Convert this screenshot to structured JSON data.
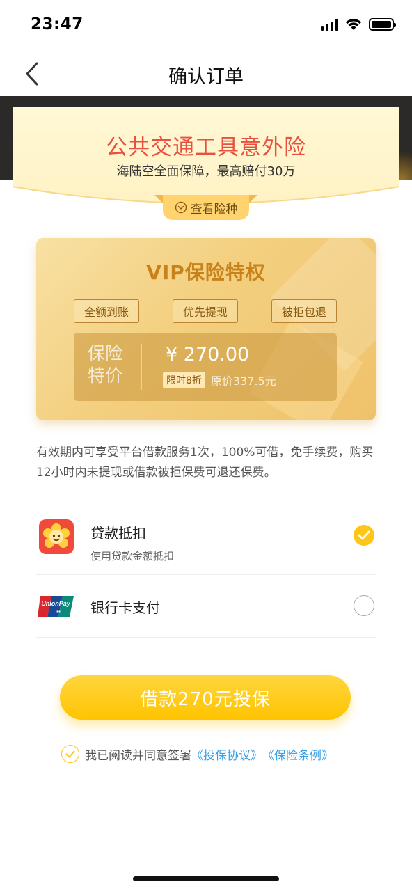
{
  "status_bar": {
    "time": "23:47"
  },
  "nav": {
    "title": "确认订单"
  },
  "banner": {
    "title": "公共交通工具意外险",
    "subtitle": "海陆空全面保障，最高赔付30万",
    "view_button": "查看险种"
  },
  "vip": {
    "title": "VIP保险特权",
    "tags": [
      "全额到账",
      "优先提现",
      "被拒包退"
    ],
    "price_label": "保险特价",
    "price": "¥ 270.00",
    "discount_badge": "限时8折",
    "original_price": "原价337.5元"
  },
  "description": "有效期内可享受平台借款服务1次，100%可借，免手续费，购买12小时内未提现或借款被拒保费可退还保费。",
  "payment": {
    "loan": {
      "name": "贷款抵扣",
      "sub": "使用贷款金额抵扣",
      "selected": true
    },
    "card": {
      "name": "银行卡支付",
      "selected": false
    }
  },
  "cta": {
    "label": "借款270元投保"
  },
  "agreement": {
    "text": "我已阅读并同意签署",
    "link1": "《投保协议》",
    "link2": "《保险条例》"
  },
  "colors": {
    "accent": "#ffc61a",
    "title_red": "#e8503f",
    "link": "#3aa0e6"
  }
}
